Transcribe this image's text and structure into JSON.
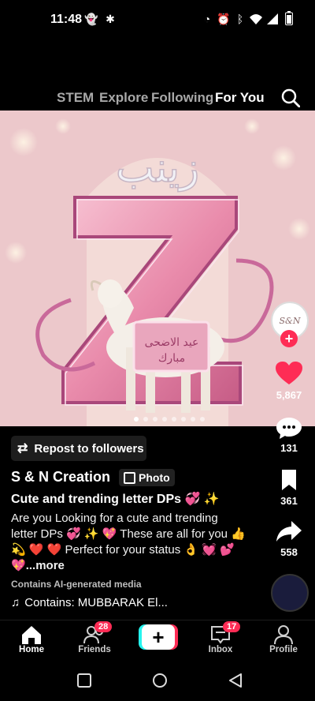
{
  "status_bar": {
    "time": "11:48",
    "icons": [
      "snapchat-icon",
      "pinwheel-icon",
      "data-saver-icon",
      "alarm-icon",
      "bluetooth-icon",
      "wifi-icon",
      "signal-icon",
      "battery-icon"
    ]
  },
  "top_nav": {
    "tabs": [
      "STEM",
      "Explore",
      "Following",
      "For You"
    ],
    "active": "For You"
  },
  "media": {
    "carousel_count": 8,
    "active_index": 0
  },
  "rail": {
    "avatar_text": "S&N",
    "likes": "5,867",
    "comments": "131",
    "saves": "361",
    "shares": "558"
  },
  "caption": {
    "repost_label": "Repost to followers",
    "author": "S & N Creation",
    "photo_badge": "Photo",
    "title": "Cute and trending letter DPs 💞 ✨",
    "description": "Are you Looking for a cute and trending letter DPs 💞 ✨ 💖 These are all for you 👍 💫 ❤️ ❤️ Perfect for your status 👌 💓 💕 💖",
    "more": "...more",
    "ai_label": "Contains AI-generated media",
    "music": "Contains: MUBBARAK El..."
  },
  "bottom_nav": {
    "home": "Home",
    "friends": "Friends",
    "friends_badge": "28",
    "inbox": "Inbox",
    "inbox_badge": "17",
    "profile": "Profile"
  },
  "colors": {
    "accent": "#fe2c55",
    "cyan": "#25f4ee"
  }
}
